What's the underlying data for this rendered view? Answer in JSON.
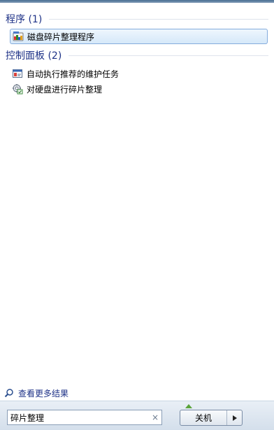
{
  "groups": [
    {
      "title": "程序 (1)",
      "items": [
        {
          "label": "磁盘碎片整理程序",
          "icon": "disk-defragmenter-icon"
        }
      ]
    },
    {
      "title": "控制面板 (2)",
      "items": [
        {
          "label": "自动执行推荐的维护任务",
          "icon": "maintenance-icon"
        },
        {
          "label": "对硬盘进行碎片整理",
          "icon": "defrag-settings-icon"
        }
      ]
    }
  ],
  "see_more": "查看更多结果",
  "search": {
    "value": "碎片整理",
    "clear_glyph": "×"
  },
  "shutdown": {
    "label": "关机"
  },
  "colors": {
    "header": "#1e3287",
    "selection_border": "#84acdd"
  }
}
